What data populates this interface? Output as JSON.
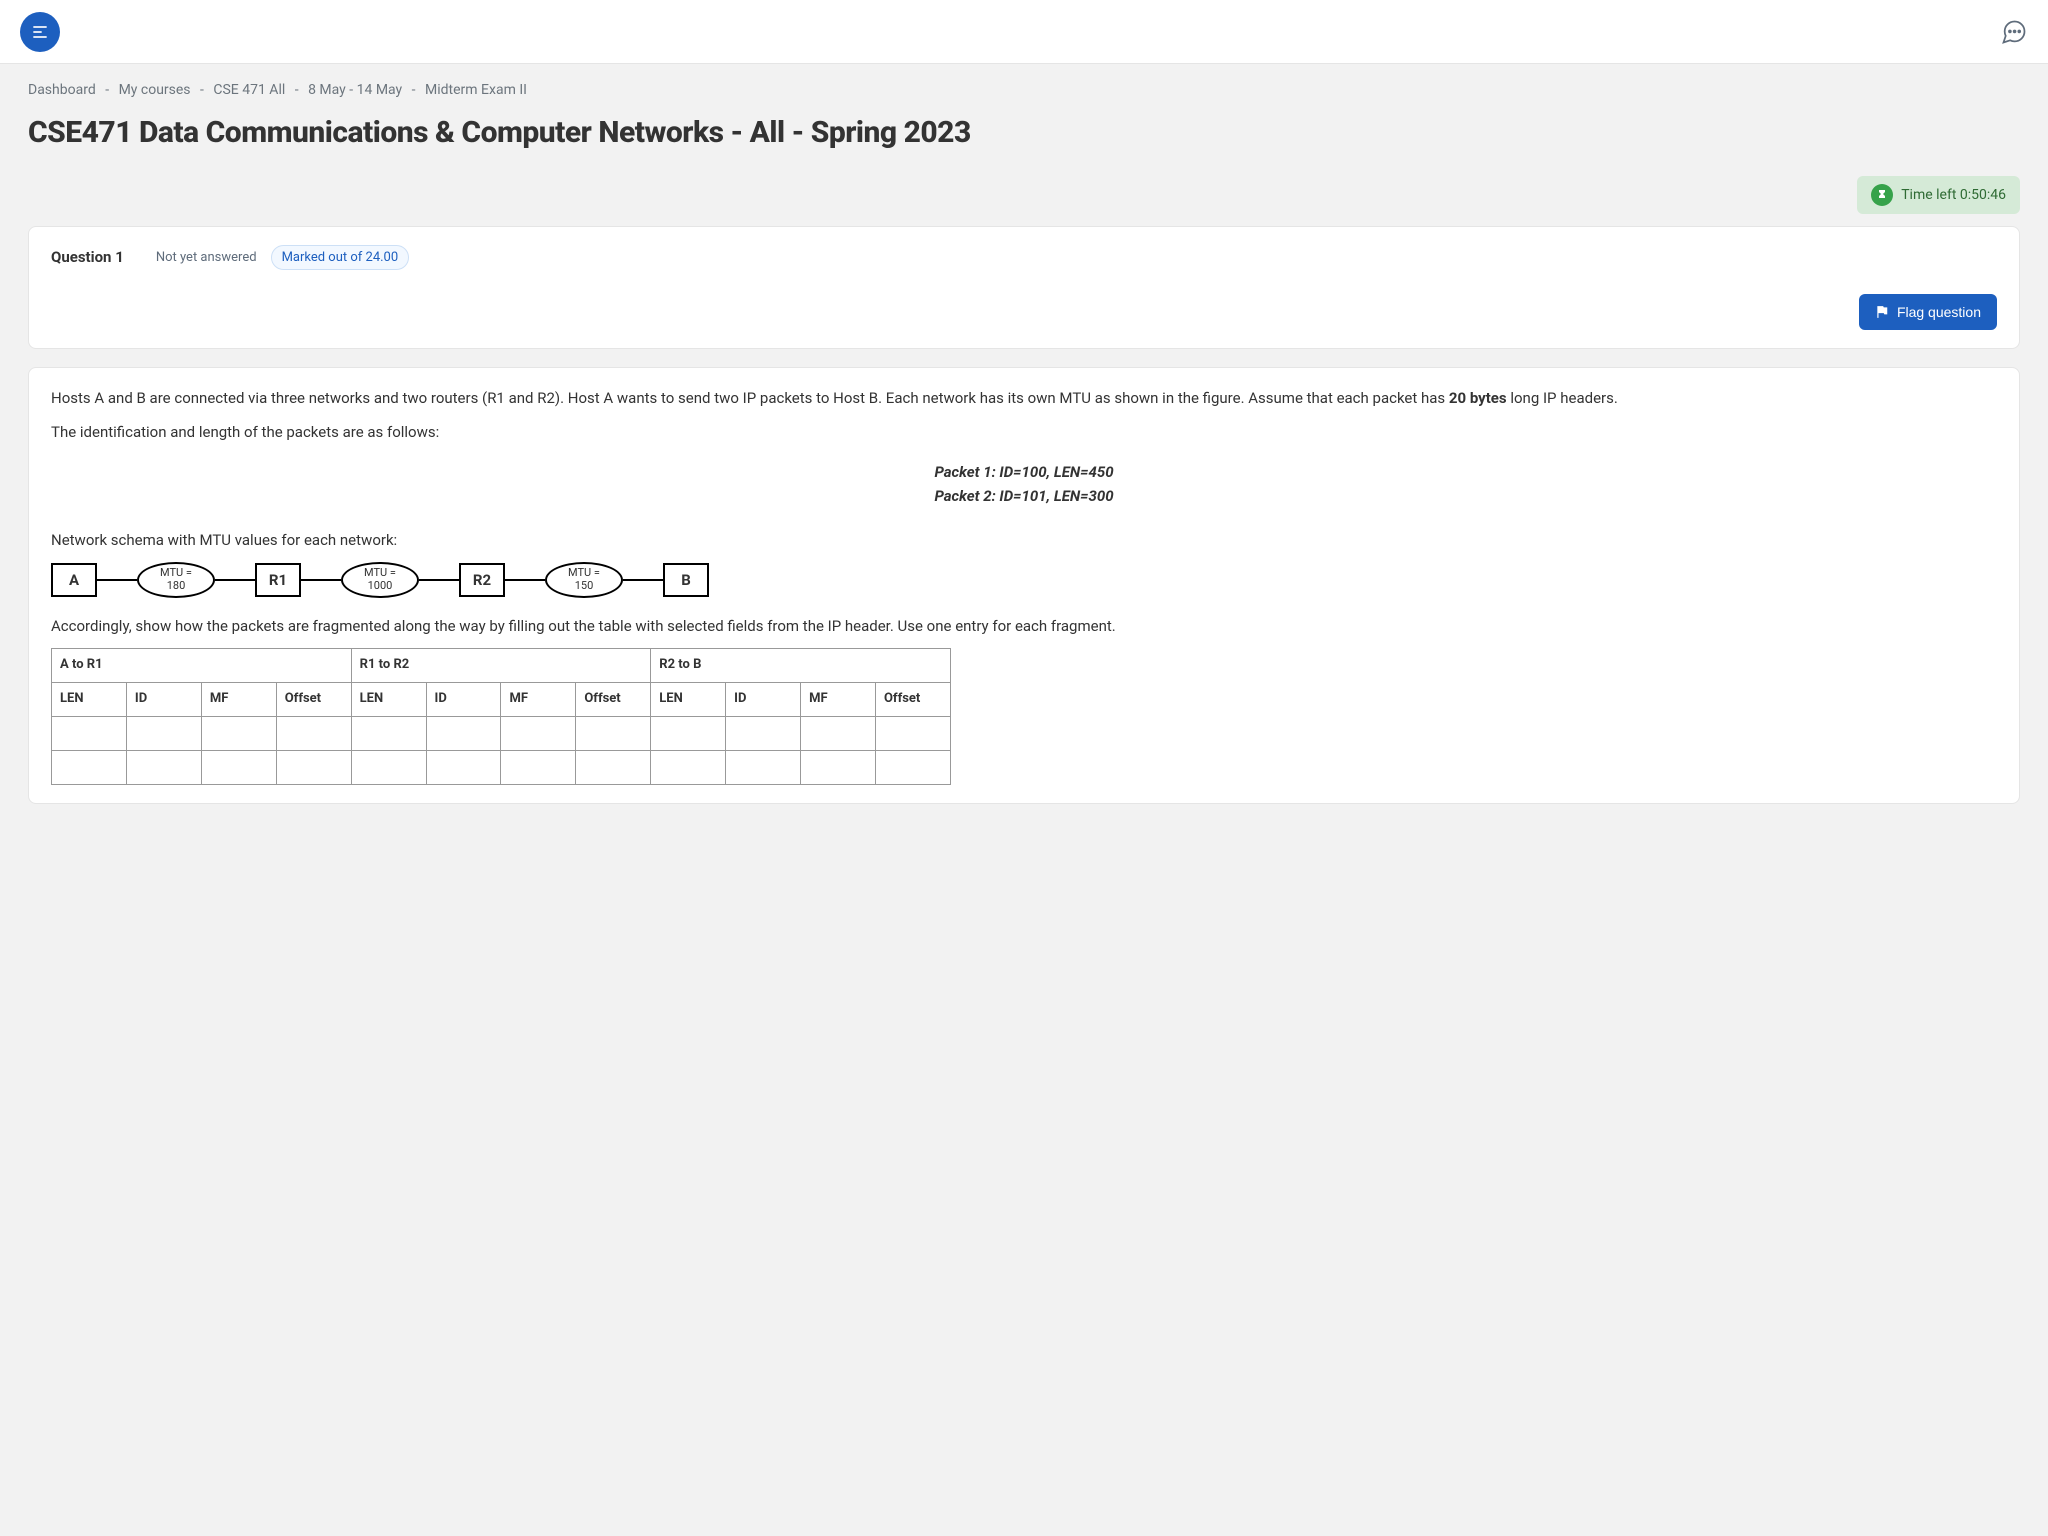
{
  "breadcrumb": {
    "items": [
      "Dashboard",
      "My courses",
      "CSE 471 All",
      "8 May - 14 May",
      "Midterm Exam II"
    ]
  },
  "page": {
    "title": "CSE471 Data Communications & Computer Networks - All - Spring 2023"
  },
  "timer": {
    "label": "Time left 0:50:46"
  },
  "question": {
    "title": "Question 1",
    "status": "Not yet answered",
    "marks": "Marked out of 24.00",
    "flag_label": "Flag question"
  },
  "content": {
    "intro": "Hosts A and B are connected via three networks and two routers (R1 and R2). Host A wants to send two IP packets to Host B.  Each network has its own MTU as shown in the figure. Assume that each packet has ",
    "bold20": "20 bytes",
    "intro_tail": " long IP headers.",
    "id_len_line": "The identification and length of the packets are as follows:",
    "packet1": "Packet 1: ID=100, LEN=450",
    "packet2": "Packet 2: ID=101, LEN=300",
    "schema_label": "Network schema with MTU values for each network:",
    "schema": {
      "A": "A",
      "R1": "R1",
      "R2": "R2",
      "B": "B",
      "mtu1_t": "MTU =",
      "mtu1_v": "180",
      "mtu2_t": "MTU =",
      "mtu2_v": "1000",
      "mtu3_t": "MTU =",
      "mtu3_v": "150"
    },
    "instruction": "Accordingly, show how the packets are fragmented along the way by filling out the table with selected fields from the IP header.  Use one entry for each fragment."
  },
  "table": {
    "sections": [
      "A to R1",
      "R1 to R2",
      "R2 to B"
    ],
    "cols": [
      "LEN",
      "ID",
      "MF",
      "Offset"
    ]
  }
}
